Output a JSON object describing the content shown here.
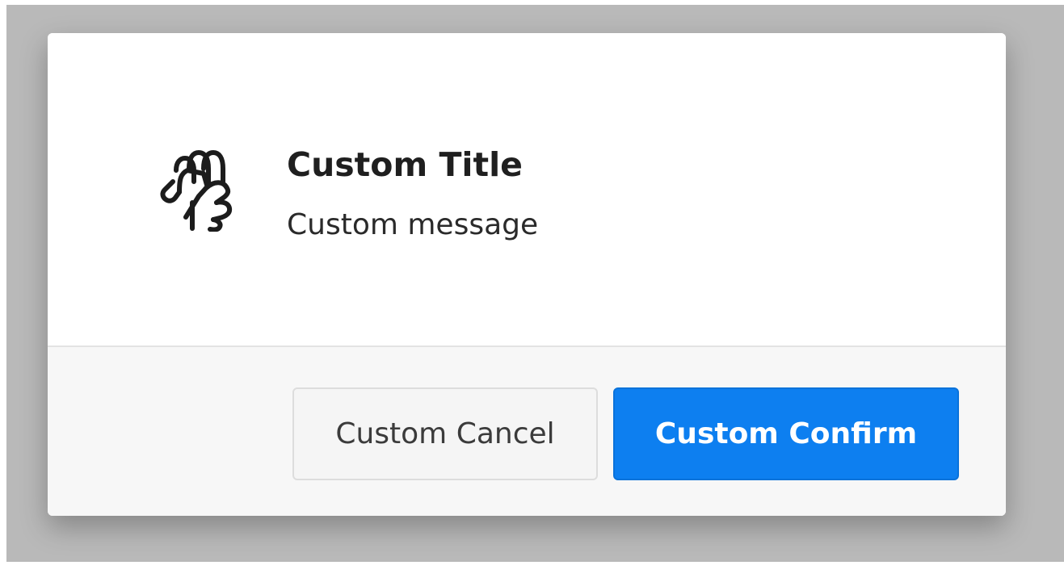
{
  "dialog": {
    "icon": "waving-hand-icon",
    "title": "Custom Title",
    "message": "Custom message",
    "cancel_label": "Custom Cancel",
    "confirm_label": "Custom Confirm"
  },
  "colors": {
    "overlay": "#b9b9b9",
    "dialog_background": "#ffffff",
    "footer_background": "#f7f7f7",
    "confirm_button": "#0d7ff0",
    "cancel_button": "#f5f5f5",
    "icon_stroke": "#1c1c1c"
  }
}
